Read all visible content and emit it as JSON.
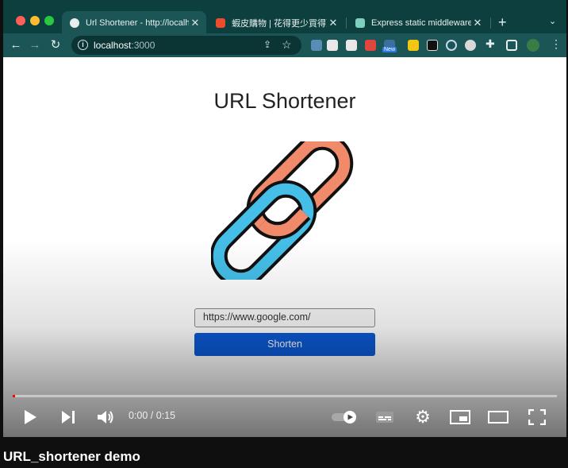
{
  "browser": {
    "tabs": [
      {
        "title": "Url Shortener - http://localhos",
        "active": true
      },
      {
        "title": "蝦皮購物 | 花得更少買得更好",
        "active": false
      },
      {
        "title": "Express static middleware.",
        "active": false
      }
    ],
    "new_tab_label": "+",
    "address": {
      "host": "localhost",
      "port": ":3000"
    },
    "extension_badge": "New"
  },
  "page": {
    "heading": "URL Shortener",
    "input_value": "https://www.google.com/",
    "button_label": "Shorten"
  },
  "player": {
    "time": "0:00 / 0:15",
    "progress_fraction": 0,
    "video_title": "URL_shortener demo"
  },
  "colors": {
    "chrome": "#0e3f3f",
    "toolbar": "#1b5555",
    "link_orange": "#f08a6a",
    "link_blue": "#45bfe8",
    "button_blue": "#0b5ad6"
  }
}
